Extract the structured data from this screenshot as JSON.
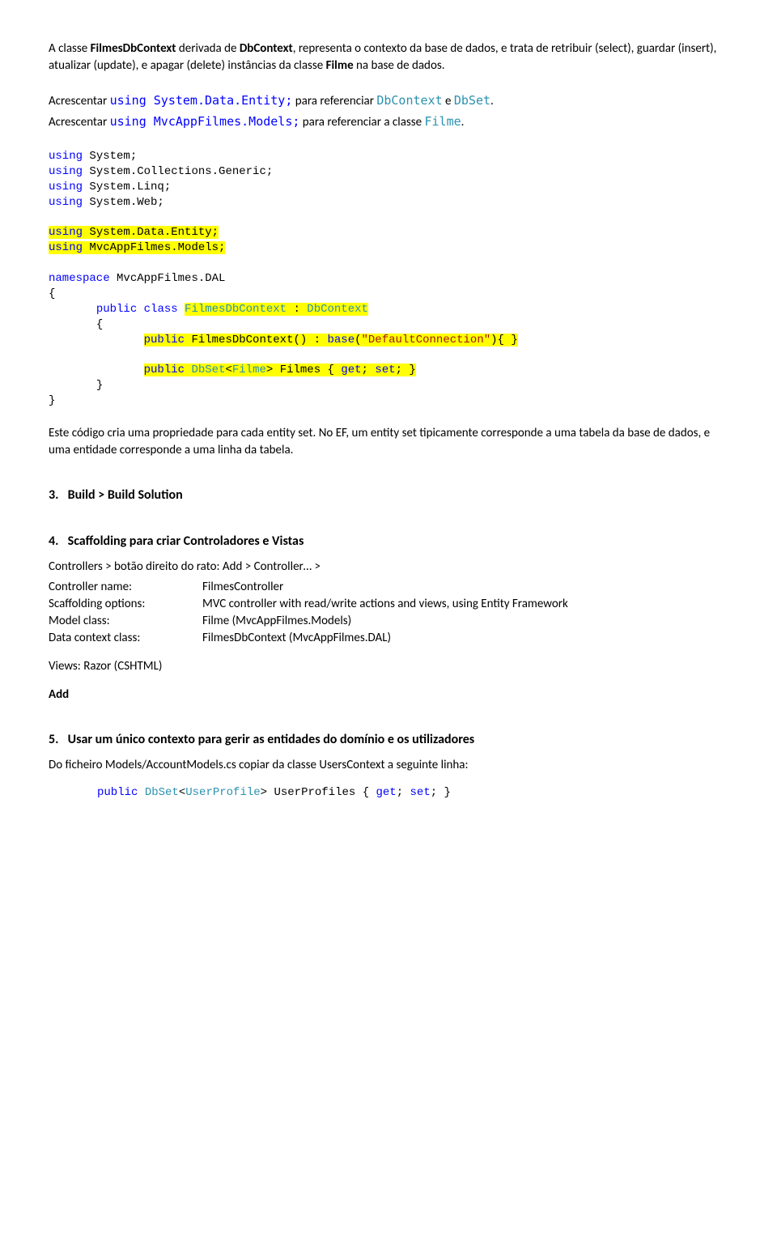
{
  "intro": {
    "p1_a": "A classe ",
    "p1_b": " derivada de ",
    "p1_c": ", representa o contexto da base de dados, e trata de retribuir (select), guardar (insert), atualizar (update), e apagar (delete) instâncias da classe ",
    "p1_d": " na base de dados.",
    "class1": "FilmesDbContext",
    "class2": "DbContext",
    "class3": "Filme"
  },
  "notes": {
    "n1_a": "Acrescentar ",
    "n1_b": " para referenciar ",
    "n1_c": " e ",
    "n1_d": ".",
    "n2_a": "Acrescentar ",
    "n2_b": " para referenciar a classe ",
    "n2_c": ".",
    "code_using1": "using System.Data.Entity;",
    "code_dbcontext": "DbContext",
    "code_dbset": "DbSet",
    "code_using2": "using MvcAppFilmes.Models;",
    "code_filme": "Filme"
  },
  "code1": {
    "l1": "using",
    "l1b": " System;",
    "l2": "using",
    "l2b": " System.Collections.Generic;",
    "l3": "using",
    "l3b": " System.Linq;",
    "l4": "using",
    "l4b": " System.Web;",
    "hl1_a": "using",
    "hl1_b": " System.Data.Entity;",
    "hl2_a": "using",
    "hl2_b": " MvcAppFilmes.Models;",
    "ns": "namespace",
    "nsv": " MvcAppFilmes.DAL",
    "ob": "{",
    "cb": "}",
    "pub": "public",
    "cls": " class ",
    "cn": "FilmesDbContext",
    "colon": " : ",
    "base": "DbContext",
    "ctor_a": "public",
    "ctor_b": " FilmesDbContext() : ",
    "ctor_c": "base",
    "ctor_d": "(",
    "ctor_e": "\"DefaultConnection\"",
    "ctor_f": "){ }",
    "prop_a": "public",
    "prop_b": " ",
    "prop_c": "DbSet",
    "prop_d": "<",
    "prop_e": "Filme",
    "prop_f": "> Filmes { ",
    "prop_g": "get",
    "prop_h": "; ",
    "prop_i": "set",
    "prop_j": "; }"
  },
  "after_code": "Este código cria uma propriedade para cada entity set. No EF, um entity set tipicamente corresponde a uma tabela da base de dados, e uma entidade corresponde a uma linha da tabela.",
  "s3": {
    "num": "3.",
    "title": "Build  >  Build Solution"
  },
  "s4": {
    "num": "4.",
    "title": "Scaffolding para criar Controladores e Vistas",
    "line1": "Controllers  >  botão direito do rato:  Add  >  Controller…  >",
    "rows": [
      {
        "label": "Controller name:",
        "value": "FilmesController"
      },
      {
        "label": "Scaffolding options:",
        "value": "MVC controller with read/write actions and views, using Entity Framework"
      },
      {
        "label": "Model class:",
        "value": "Filme (MvcAppFilmes.Models)"
      },
      {
        "label": "Data context class:",
        "value": "FilmesDbContext (MvcAppFilmes.DAL)"
      }
    ],
    "views": "Views: Razor (CSHTML)",
    "add": "Add"
  },
  "s5": {
    "num": "5.",
    "title": "Usar um único contexto para gerir as entidades do domínio e os utilizadores",
    "line1": "Do ficheiro Models/AccountModels.cs copiar da classe UsersContext a seguinte linha:",
    "code": {
      "a": "public",
      "b": " ",
      "c": "DbSet",
      "d": "<",
      "e": "UserProfile",
      "f": "> UserProfiles { ",
      "g": "get",
      "h": "; ",
      "i": "set",
      "j": "; }"
    }
  }
}
